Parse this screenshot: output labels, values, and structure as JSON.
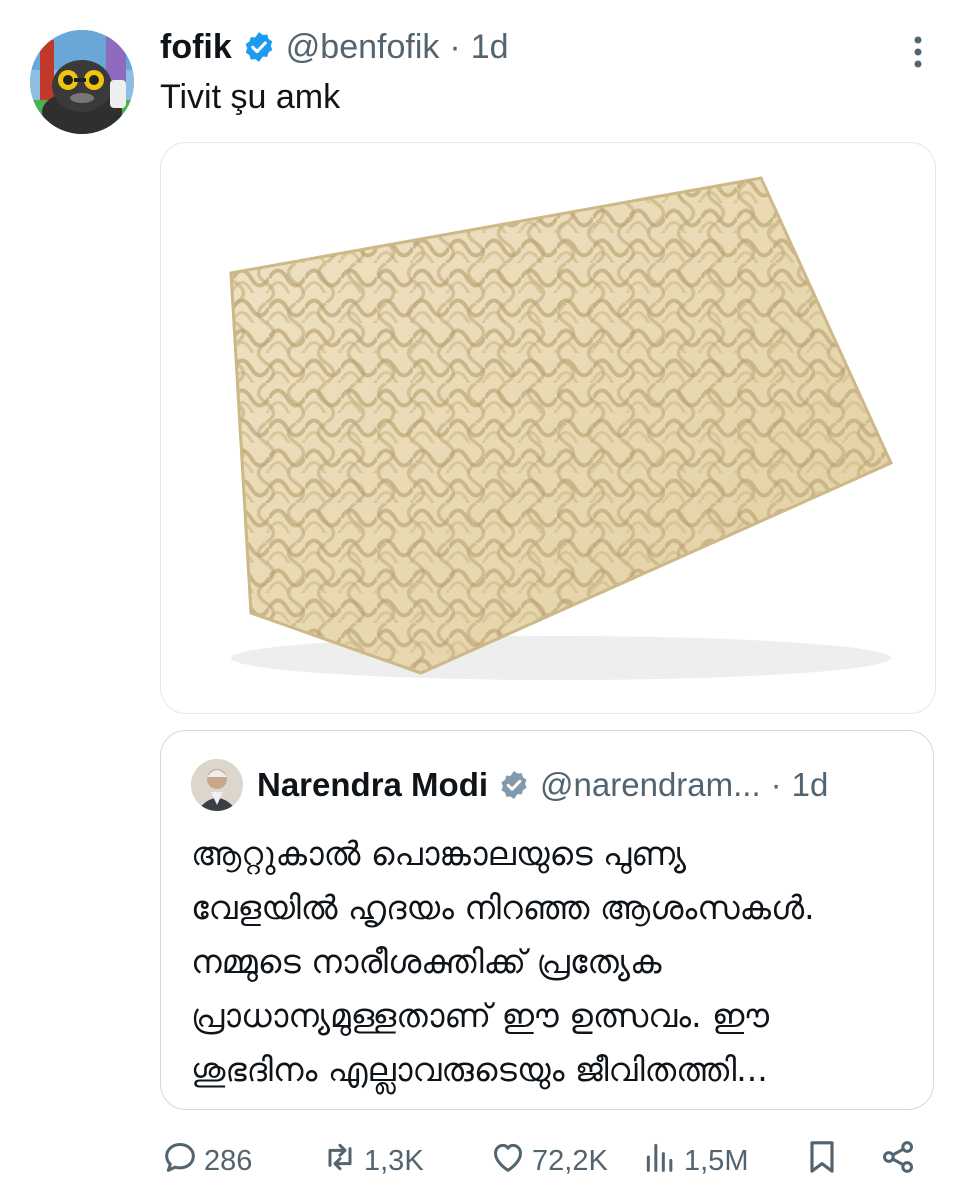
{
  "tweet": {
    "name": "fofik",
    "handle": "@benfofik",
    "separator": "·",
    "time": "1d",
    "text": "Tivit şu amk"
  },
  "quote": {
    "name": "Narendra Modi",
    "handle": "@narendram...",
    "separator": "·",
    "time": "1d",
    "lines": [
      "ആറ്റുകാൽ പൊങ്കാലയുടെ പുണ്യ",
      "വേളയിൽ ഹൃദയം നിറഞ്ഞ ആശംസകൾ.",
      "നമ്മുടെ നാരീശക്തിക്ക് പ്രത്യേക",
      "പ്രാധാന്യമുള്ളതാണ് ഈ ഉത്സവം. ഈ",
      "ശുഭദിനം എല്ലാവരുടെയും ജീവിതത്തി..."
    ]
  },
  "actions": {
    "replies": "286",
    "reposts": "1,3K",
    "likes": "72,2K",
    "views": "1,5M"
  },
  "colors": {
    "text": "#0f1419",
    "secondary": "#536471",
    "verified": "#1d9bf0",
    "quote_verified": "#829aab",
    "border": "#cfd9de"
  },
  "icons": [
    "verified-icon",
    "more-icon",
    "reply-icon",
    "repost-icon",
    "like-icon",
    "views-icon",
    "bookmark-icon",
    "share-icon"
  ]
}
